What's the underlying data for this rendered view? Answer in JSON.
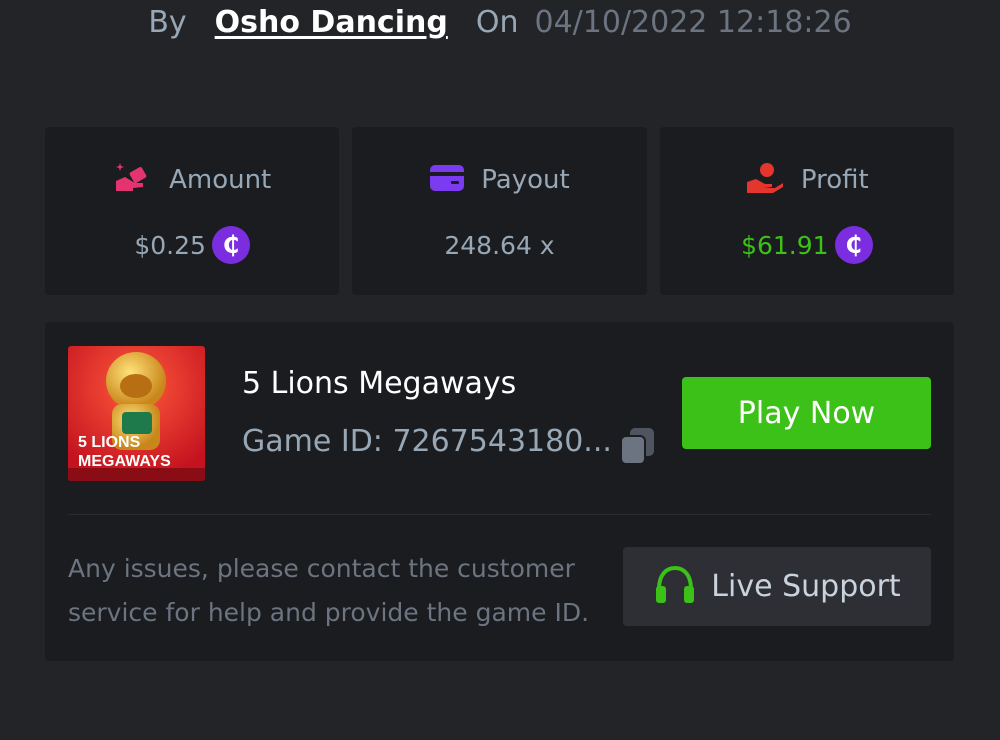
{
  "byline": {
    "by": "By",
    "user": "Osho Dancing",
    "on": "On",
    "datetime": "04/10/2022 12:18:26"
  },
  "stats": [
    {
      "label": "Amount",
      "value": "$0.25",
      "icon": "amount-hand-icon",
      "icon_color": "#e4346f",
      "value_color": "#98a7b5",
      "coin": true
    },
    {
      "label": "Payout",
      "value": "248.64 x",
      "icon": "wallet-card-icon",
      "icon_color": "#7b3bf0",
      "value_color": "#98a7b5",
      "coin": false
    },
    {
      "label": "Profit",
      "value": "$61.91",
      "icon": "hand-profit-icon",
      "icon_color": "#e4362d",
      "value_color": "#3bc117",
      "coin": true
    }
  ],
  "coin_symbol": "₵",
  "game": {
    "title": "5 Lions Megaways",
    "id_label": "Game ID: 7267543180...",
    "thumb_line1": "5 LIONS",
    "thumb_line2": "MEGAWAYS",
    "play_label": "Play Now"
  },
  "help": {
    "text": "Any issues, please contact the customer service for help and provide the game ID.",
    "support_label": "Live Support"
  },
  "colors": {
    "background": "#232428",
    "card": "#1b1c1f",
    "accent_green": "#3bc117",
    "coin_purple": "#7b2ee0"
  }
}
